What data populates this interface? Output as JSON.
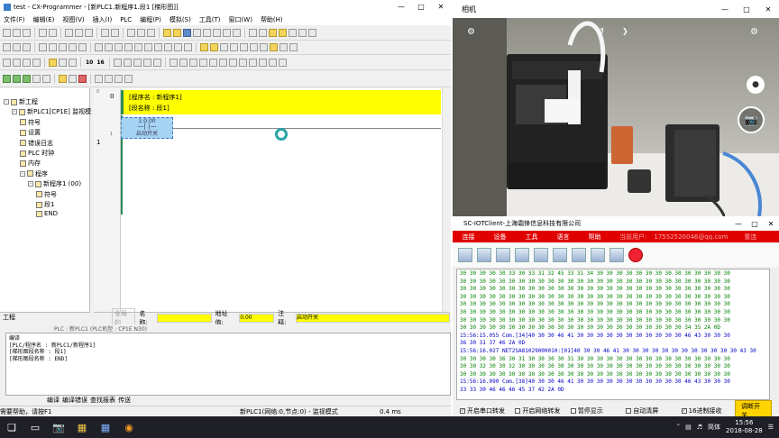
{
  "cx": {
    "title": "test - CX-Programmer - [新PLC1.新程序1.段1 [梯形图]]",
    "menu": [
      "文件(F)",
      "编辑(E)",
      "视图(V)",
      "插入(I)",
      "PLC",
      "编程(P)",
      "模拟(S)",
      "工具(T)",
      "窗口(W)",
      "帮助(H)"
    ],
    "toolbar_text": {
      "num10": "10",
      "num16": "16"
    },
    "tree": [
      {
        "label": "新工程",
        "indent": 0
      },
      {
        "label": "新PLC1[CP1E] 监视模",
        "indent": 1
      },
      {
        "label": "符号",
        "indent": 2
      },
      {
        "label": "设置",
        "indent": 2
      },
      {
        "label": "错误日志",
        "indent": 2
      },
      {
        "label": "PLC 时钟",
        "indent": 2
      },
      {
        "label": "内存",
        "indent": 2
      },
      {
        "label": "程序",
        "indent": 2
      },
      {
        "label": "新程序1 (00)",
        "indent": 3
      },
      {
        "label": "符号",
        "indent": 4
      },
      {
        "label": "段1",
        "indent": 4
      },
      {
        "label": "END",
        "indent": 4
      }
    ],
    "tree_tab": "工程",
    "ladder": {
      "rung0_num": "0",
      "rung0_step": "0",
      "rung1_num": "1",
      "rung1_step": "1",
      "program_name": "[程序名 : 新程序1]",
      "section_name": "[段名称 : 段1]",
      "contact_addr": "1:0.00",
      "contact_comment": "启动开关"
    },
    "statusbar": {
      "global": "全局的",
      "name_label": "名称:",
      "addr_label": "地址值:",
      "addr_value": "0.00",
      "comment_label": "注释:",
      "comment_value": "启动开关"
    },
    "output_header": "PLC : 新PLC1 (PLC机型 : CP1E N30)",
    "output_lines": [
      "编译",
      "[PLC/程序名 : 新PLC1/新程序1]",
      "[梯形图段名称 : 段1]",
      "[梯形图段名称 : END]"
    ],
    "output_tabs": [
      "编译",
      "编译错误",
      "查找报表",
      "传送"
    ],
    "status": {
      "help": "需要帮助，请按F1",
      "net": "新PLC1(网络:0,节点:0) - 监视模式",
      "time": "0.4 ms"
    }
  },
  "camera": {
    "title": "相机"
  },
  "sc": {
    "title": "SC-IOTClient-上海霜锋信息科技有限公司",
    "menu": [
      "连接",
      "设备",
      "工具",
      "语言",
      "帮助",
      "当前用户:",
      "17552520046@qq.com",
      "重连"
    ],
    "log": [
      {
        "t": "tx",
        "s": "30 30 30 30 30 33 30 33 31 32 45 33 31 34 30 30 30 30 30 30 30 30 30 30 30 30 30 30"
      },
      {
        "t": "tx",
        "s": "30 30 30 30 30 30 30 30 30 30 30 30 30 30 30 30 30 30 30 30 30 30 30 30 30 30 30 30"
      },
      {
        "t": "tx",
        "s": "30 30 30 30 30 30 30 30 30 30 30 30 30 30 30 30 30 30 30 30 30 30 30 30 30 30 30 30"
      },
      {
        "t": "tx",
        "s": "30 30 30 30 30 30 30 30 30 30 30 30 30 30 30 30 30 30 30 30 30 30 30 30 30 30 30 30"
      },
      {
        "t": "tx",
        "s": "30 30 30 30 30 30 30 30 30 30 30 30 30 30 30 30 30 30 30 30 30 30 30 30 30 30 30 30"
      },
      {
        "t": "tx",
        "s": "30 30 30 30 30 30 30 30 30 30 30 30 30 30 30 30 30 30 30 30 30 30 30 30 30 30 30 30"
      },
      {
        "t": "tx",
        "s": "30 30 30 30 30 30 30 30 30 30 30 30 30 30 30 30 30 30 30 30 30 30 30 30 30 30 30 30"
      },
      {
        "t": "tx",
        "s": "30 30 30 30 30 30 30 30 30 30 30 30 30 30 30 30 30 30 30 30 30 30 30 34 35 2A 0D"
      },
      {
        "t": "rx",
        "s": "15:56:15.055 Com.[34]40 30 30 46 41 30 30 30 30 30 30 30 30 30 30 30 46 43 30 30 30"
      },
      {
        "t": "rx",
        "s": "36 30 31 37 46 2A 0D"
      },
      {
        "t": "rx",
        "s": "15:56:16.027 NET2SA81029000010:[01]40 30 30 46 41 30 30 30 30 30 30 30 30 30 30 30 30 43 30"
      },
      {
        "t": "tx",
        "s": "30 30 30 30 36 30 31 30 30 30 30 31 30 30 30 30 30 30 30 30 30 30 30 30 30 30 30 30"
      },
      {
        "t": "tx",
        "s": "30 30 32 30 30 32 30 30 30 30 30 30 30 30 30 30 30 30 30 30 30 30 30 30 30 30 30 30"
      },
      {
        "t": "tx",
        "s": "30 30 30 30 30 30 30 30 30 30 30 30 30 30 30 30 30 30 30 30 30 30 30 30 30 30 30 30"
      },
      {
        "t": "rx",
        "s": "15:56:16.090 Com.[38]40 30 30 46 41 30 30 30 30 30 30 30 30 30 30 30 46 43 30 30 30"
      },
      {
        "t": "rx",
        "s": "33 33 30 46 46 46 45 37 42 2A 0D"
      }
    ],
    "checks": [
      {
        "label": "开启串口转发",
        "on": true
      },
      {
        "label": "开启网络转发",
        "on": false
      },
      {
        "label": "暂停显示",
        "on": false
      },
      {
        "label": "自动清屏",
        "on": false
      },
      {
        "label": "16进制接收",
        "on": true
      }
    ],
    "debug_btn": "调断开关"
  },
  "taskbar": {
    "lang": "简体",
    "time": "15:56",
    "date": "2018-08-28"
  }
}
